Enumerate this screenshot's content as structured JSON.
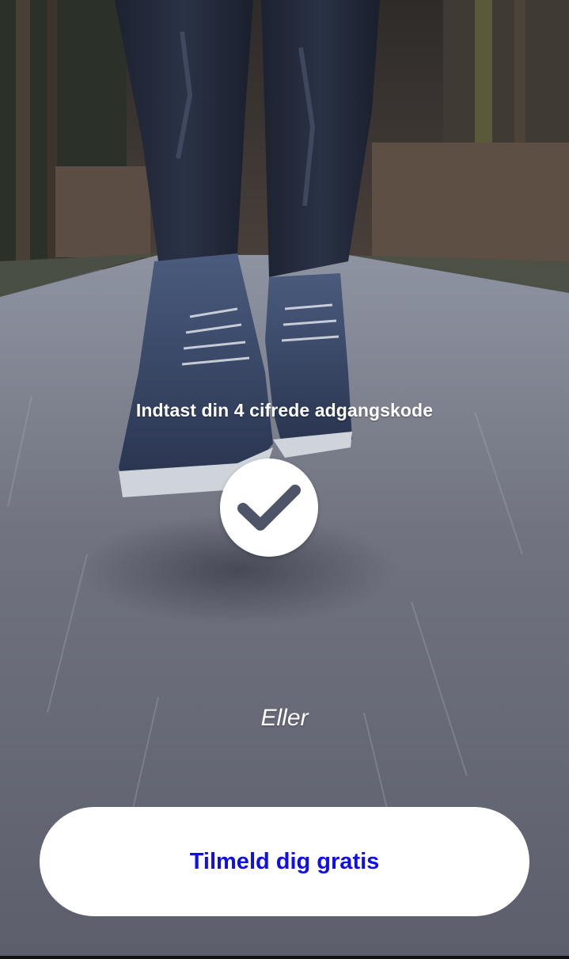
{
  "background": {
    "description_icon": "running-shoes-photo",
    "colors": {
      "road": "#6c6f7e",
      "trees": "#3b3633",
      "shoes": "#2b3a5a"
    }
  },
  "login": {
    "prompt": "Indtast din 4 cifrede adgangskode",
    "submit_icon": "checkmark-icon",
    "submit_icon_color": "#4e5568"
  },
  "separator": {
    "label": "Eller"
  },
  "signup": {
    "label": "Tilmeld dig gratis",
    "label_color": "#1010e6"
  }
}
